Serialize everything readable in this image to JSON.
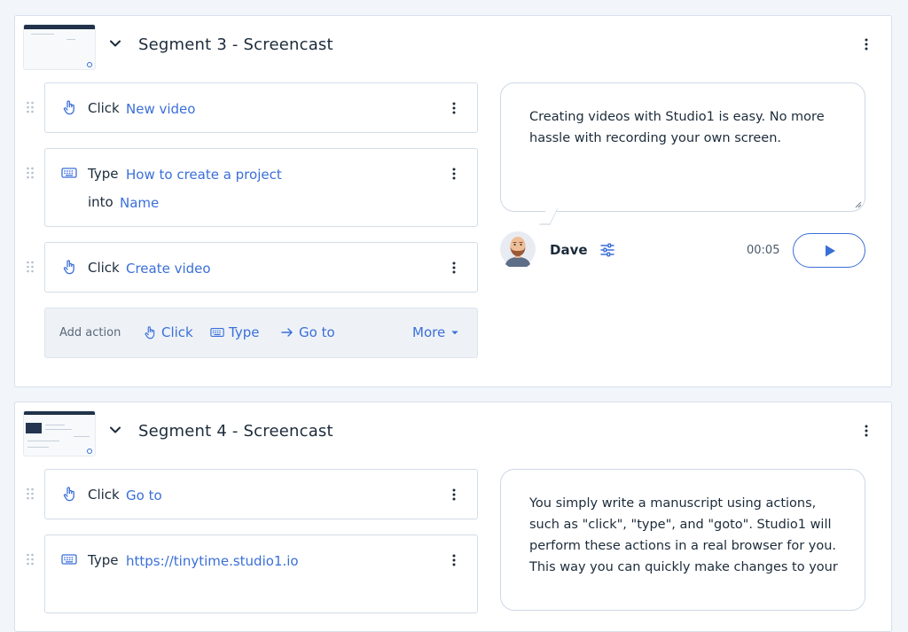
{
  "segments": [
    {
      "title": "Segment 3 - Screencast",
      "actions": [
        {
          "verb": "Click",
          "value": "New video"
        },
        {
          "verb": "Type",
          "value": "How to create a project",
          "into_label": "into",
          "target": "Name"
        },
        {
          "verb": "Click",
          "value": "Create video"
        }
      ],
      "add_bar": {
        "label": "Add action",
        "click": "Click",
        "type": "Type",
        "goto": "Go to",
        "more": "More"
      },
      "script": "Creating videos with Studio1 is easy. No more hassle with recording your own screen.",
      "speaker": "Dave",
      "duration": "00:05"
    },
    {
      "title": "Segment 4 - Screencast",
      "actions": [
        {
          "verb": "Click",
          "value": "Go to"
        },
        {
          "verb": "Type",
          "value": "https://tinytime.studio1.io"
        }
      ],
      "script": "You simply write a manuscript using actions, such as \"click\", \"type\", and \"goto\". Studio1 will perform these actions in a real browser for you. This way you can quickly make changes to your"
    }
  ],
  "icons": {
    "expand": "chevron-down-icon",
    "menu": "kebab-menu-icon",
    "drag": "drag-handle-icon",
    "click": "pointer-hand-icon",
    "type": "keyboard-icon",
    "goto": "arrow-right-icon",
    "more": "caret-down-icon",
    "voice": "sliders-icon",
    "play": "play-icon"
  },
  "colors": {
    "accent": "#3a6fd8",
    "text": "#1c2b3a",
    "border": "#d3dce7",
    "background": "#f2f5f9"
  }
}
